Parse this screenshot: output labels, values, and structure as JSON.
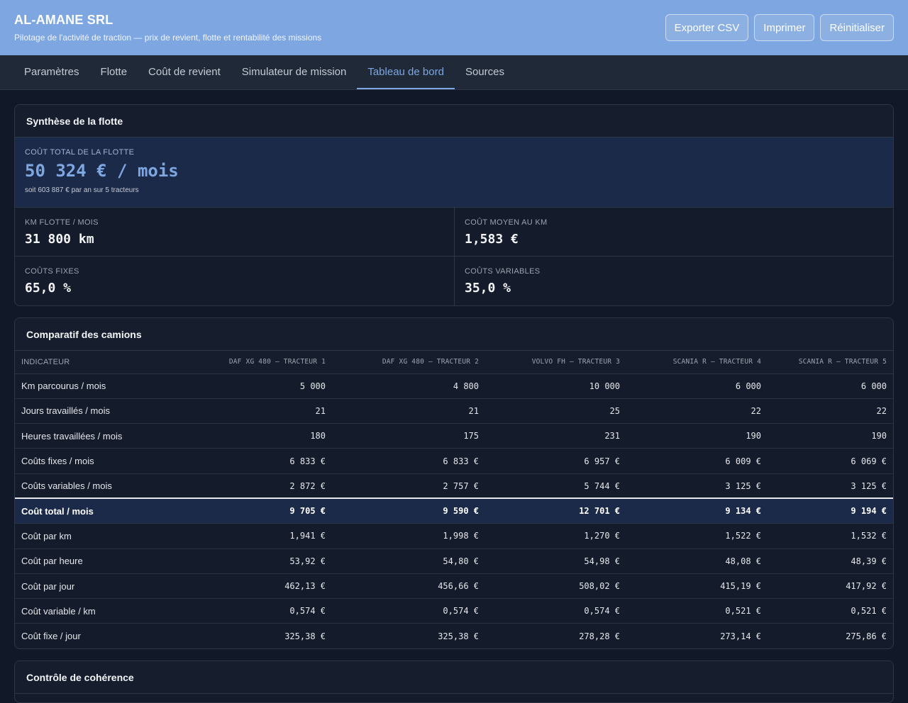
{
  "header": {
    "title": "AL-AMANE SRL",
    "subtitle": "Pilotage de l'activité de traction — prix de revient, flotte et rentabilité des missions",
    "buttons": [
      "Exporter CSV",
      "Imprimer",
      "Réinitialiser"
    ]
  },
  "tabs": [
    "Paramètres",
    "Flotte",
    "Coût de revient",
    "Simulateur de mission",
    "Tableau de bord",
    "Sources"
  ],
  "active_tab": "Tableau de bord",
  "synthese": {
    "title": "Synthèse de la flotte",
    "main_label": "Coût total de la flotte",
    "main_value": "50 324 € / mois",
    "main_note": "soit 603 887 € par an sur 5 tracteurs",
    "kpis": [
      {
        "label": "Km flotte / mois",
        "value": "31 800 km"
      },
      {
        "label": "Coût moyen au km",
        "value": "1,583 €"
      },
      {
        "label": "Coûts fixes",
        "value": "65,0 %"
      },
      {
        "label": "Coûts variables",
        "value": "35,0 %"
      }
    ]
  },
  "comparatif": {
    "title": "Comparatif des camions",
    "columns": [
      "Indicateur",
      "DAF XG 480 — Tracteur 1",
      "DAF XG 480 — Tracteur 2",
      "Volvo FH — Tracteur 3",
      "Scania R — Tracteur 4",
      "Scania R — Tracteur 5"
    ],
    "rows": [
      {
        "label": "Km parcourus / mois",
        "values": [
          "5 000",
          "4 800",
          "10 000",
          "6 000",
          "6 000"
        ]
      },
      {
        "label": "Jours travaillés / mois",
        "values": [
          "21",
          "21",
          "25",
          "22",
          "22"
        ]
      },
      {
        "label": "Heures travaillées / mois",
        "values": [
          "180",
          "175",
          "231",
          "190",
          "190"
        ]
      },
      {
        "label": "Coûts fixes / mois",
        "values": [
          "6 833 €",
          "6 833 €",
          "6 957 €",
          "6 009 €",
          "6 069 €"
        ]
      },
      {
        "label": "Coûts variables / mois",
        "values": [
          "2 872 €",
          "2 757 €",
          "5 744 €",
          "3 125 €",
          "3 125 €"
        ]
      },
      {
        "label": "Coût total / mois",
        "values": [
          "9 705 €",
          "9 590 €",
          "12 701 €",
          "9 134 €",
          "9 194 €"
        ],
        "total": true
      },
      {
        "label": "Coût par km",
        "values": [
          "1,941 €",
          "1,998 €",
          "1,270 €",
          "1,522 €",
          "1,532 €"
        ]
      },
      {
        "label": "Coût par heure",
        "values": [
          "53,92 €",
          "54,80 €",
          "54,98 €",
          "48,08 €",
          "48,39 €"
        ]
      },
      {
        "label": "Coût par jour",
        "values": [
          "462,13 €",
          "456,66 €",
          "508,02 €",
          "415,19 €",
          "417,92 €"
        ]
      },
      {
        "label": "Coût variable / km",
        "values": [
          "0,574 €",
          "0,574 €",
          "0,574 €",
          "0,521 €",
          "0,521 €"
        ]
      },
      {
        "label": "Coût fixe / jour",
        "values": [
          "325,38 €",
          "325,38 €",
          "278,28 €",
          "273,14 €",
          "275,86 €"
        ]
      }
    ]
  },
  "coherence": {
    "title": "Contrôle de cohérence"
  }
}
